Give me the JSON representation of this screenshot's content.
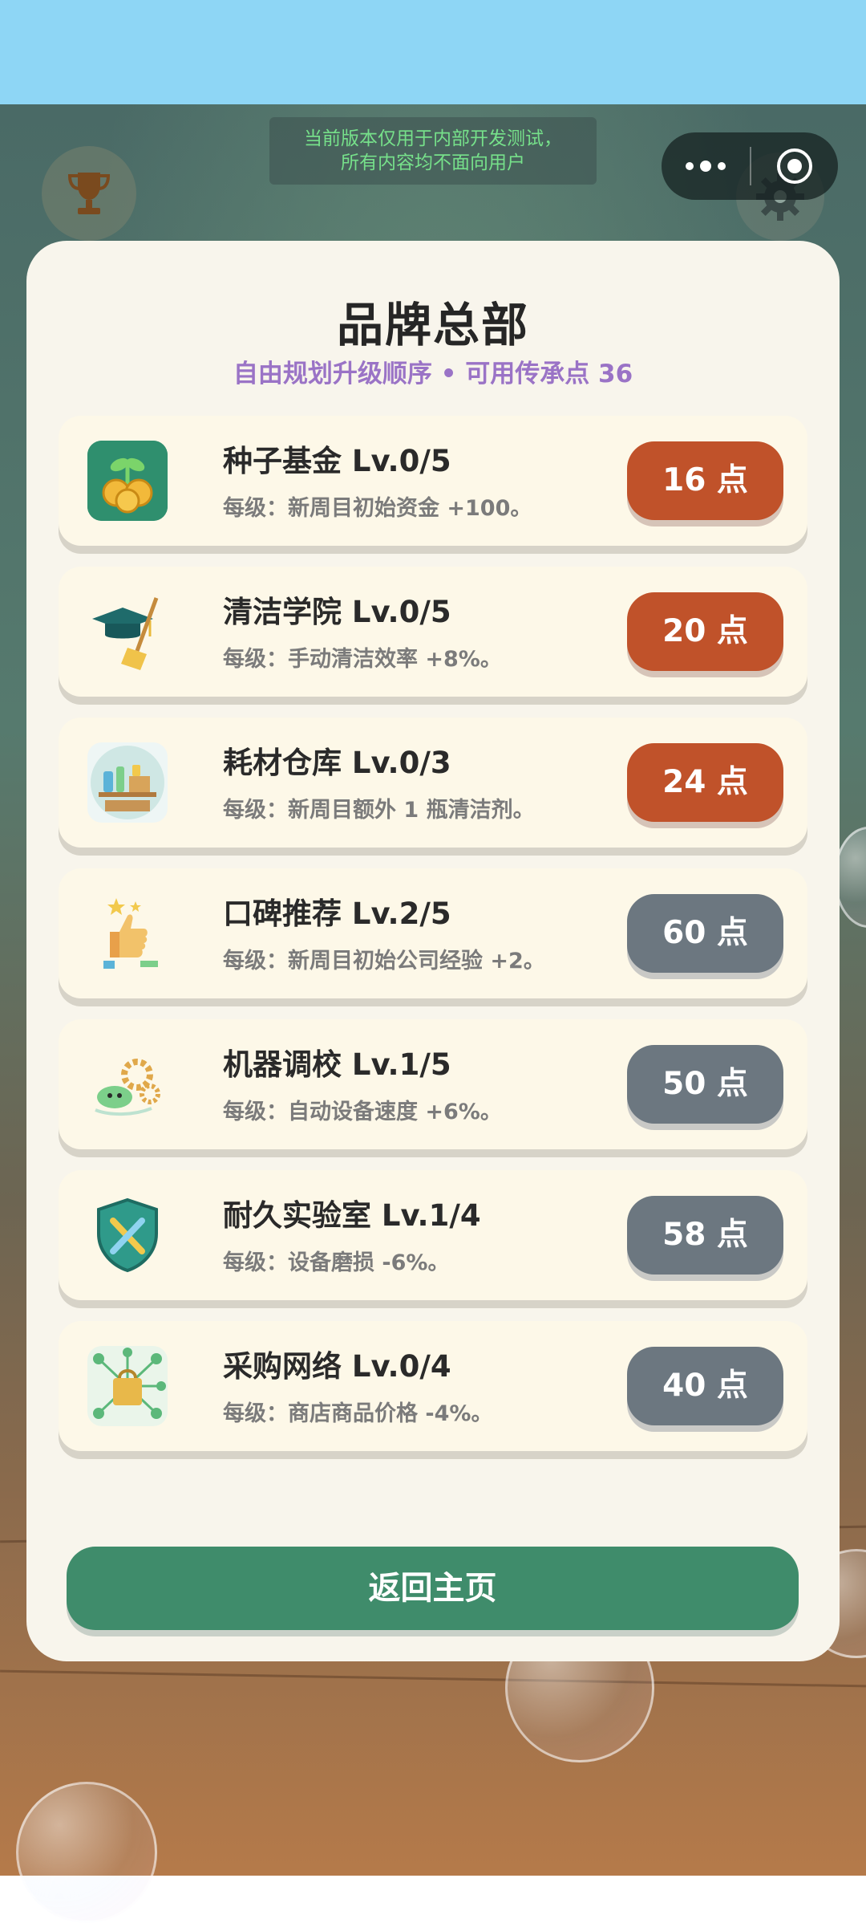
{
  "notice": {
    "line1": "当前版本仅用于内部开发测试，",
    "line2": "所有内容均不面向用户"
  },
  "header": {
    "title": "品牌总部",
    "subtitle": "自由规划升级顺序 • 可用传承点 36"
  },
  "upgrades": [
    {
      "name": "种子基金 Lv.0/5",
      "desc": "每级：新周目初始资金 +100。",
      "cost": "16 点",
      "affordable": true,
      "icon": "seed-coins-icon"
    },
    {
      "name": "清洁学院 Lv.0/5",
      "desc": "每级：手动清洁效率 +8%。",
      "cost": "20 点",
      "affordable": true,
      "icon": "graduation-broom-icon"
    },
    {
      "name": "耗材仓库 Lv.0/3",
      "desc": "每级：新周目额外 1 瓶清洁剂。",
      "cost": "24 点",
      "affordable": true,
      "icon": "supply-shelf-icon"
    },
    {
      "name": "口碑推荐 Lv.2/5",
      "desc": "每级：新周目初始公司经验 +2。",
      "cost": "60 点",
      "affordable": false,
      "icon": "thumbs-up-icon"
    },
    {
      "name": "机器调校 Lv.1/5",
      "desc": "每级：自动设备速度 +6%。",
      "cost": "50 点",
      "affordable": false,
      "icon": "robot-gears-icon"
    },
    {
      "name": "耐久实验室 Lv.1/4",
      "desc": "每级：设备磨损 -6%。",
      "cost": "58 点",
      "affordable": false,
      "icon": "shield-tools-icon"
    },
    {
      "name": "采购网络 Lv.0/4",
      "desc": "每级：商店商品价格 -4%。",
      "cost": "40 点",
      "affordable": false,
      "icon": "shopping-network-icon"
    }
  ],
  "footer": {
    "home_label": "返回主页"
  },
  "colors": {
    "affordable": "#c0522a",
    "locked": "#6c7780",
    "home": "#3f8c6b",
    "subtitle": "#9a73c6"
  }
}
